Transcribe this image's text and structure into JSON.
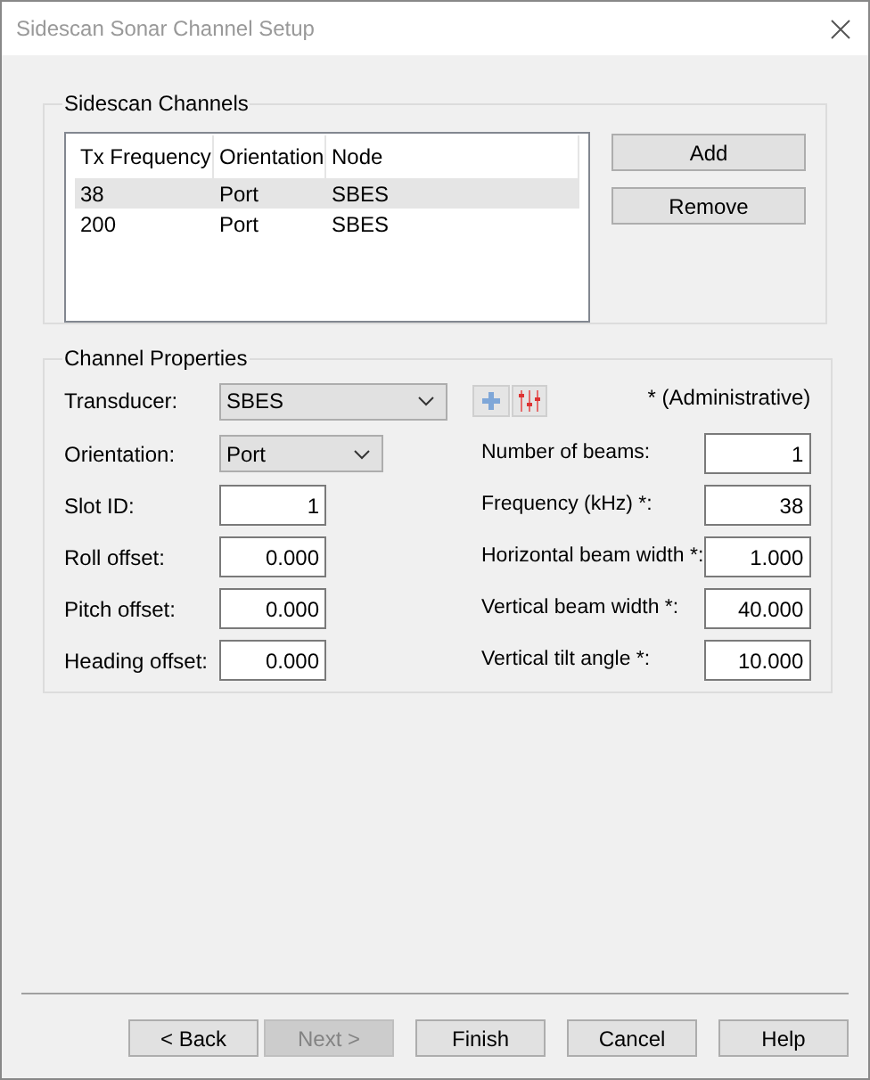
{
  "window": {
    "title": "Sidescan Sonar Channel Setup",
    "active": false
  },
  "sidescan_channels": {
    "title": "Sidescan Channels",
    "columns": [
      "Tx Frequency",
      "Orientation",
      "Node"
    ],
    "rows": [
      {
        "cells": [
          "38",
          "Port",
          "SBES"
        ],
        "selected": true
      },
      {
        "cells": [
          "200",
          "Port",
          "SBES"
        ],
        "selected": false
      }
    ],
    "buttons": [
      "Add",
      "Remove"
    ]
  },
  "channel_properties": {
    "title": "Channel Properties",
    "transducer": {
      "label": "Transducer:",
      "value": "SBES"
    },
    "note": "* (Administrative)",
    "left_fields": [
      {
        "kind": "dropdown",
        "label": "Orientation:",
        "value": "Port"
      },
      {
        "kind": "field",
        "label": "Slot ID:",
        "value": "1"
      },
      {
        "kind": "field",
        "label": "Roll offset:",
        "value": "0.000"
      },
      {
        "kind": "field",
        "label": "Pitch offset:",
        "value": "0.000"
      },
      {
        "kind": "field",
        "label": "Heading offset:",
        "value": "0.000"
      }
    ],
    "right_fields": [
      {
        "label": "Number of beams:",
        "value": "1"
      },
      {
        "label": "Frequency (kHz) *:",
        "value": "38"
      },
      {
        "label": "Horizontal beam width *:",
        "value": "1.000"
      },
      {
        "label": "Vertical beam width *:",
        "value": "40.000"
      },
      {
        "label": "Vertical tilt angle *:",
        "value": "10.000"
      }
    ]
  },
  "buttons": [
    {
      "label": "< Back",
      "disabled": false
    },
    {
      "label": "Next >",
      "disabled": true
    },
    {
      "label": "Finish",
      "disabled": false
    },
    {
      "label": "Cancel",
      "disabled": false
    },
    {
      "label": "Help",
      "disabled": false
    }
  ]
}
